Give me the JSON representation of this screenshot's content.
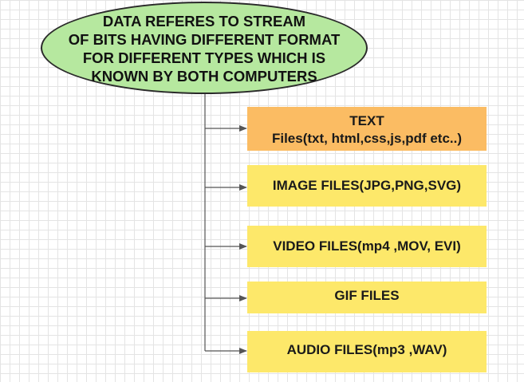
{
  "root": {
    "text": "DATA REFERES TO STREAM\nOF BITS HAVING DIFFERENT FORMAT\nFOR DIFFERENT TYPES WHICH IS\nKNOWN BY BOTH COMPUTERS",
    "fill": "#b6e89f",
    "stroke": "#2a2a2a"
  },
  "children": [
    {
      "lines": [
        "TEXT",
        "Files(txt, html,css,js,pdf etc..)"
      ],
      "fill": "#fbbc63"
    },
    {
      "lines": [
        "IMAGE FILES(JPG,PNG,SVG)"
      ],
      "fill": "#fde86a"
    },
    {
      "lines": [
        "VIDEO FILES(mp4 ,MOV, EVI)"
      ],
      "fill": "#fde86a"
    },
    {
      "lines": [
        "GIF FILES"
      ],
      "fill": "#fde86a"
    },
    {
      "lines": [
        "AUDIO FILES(mp3 ,WAV)"
      ],
      "fill": "#fde86a"
    }
  ],
  "connector_color": "#555555"
}
